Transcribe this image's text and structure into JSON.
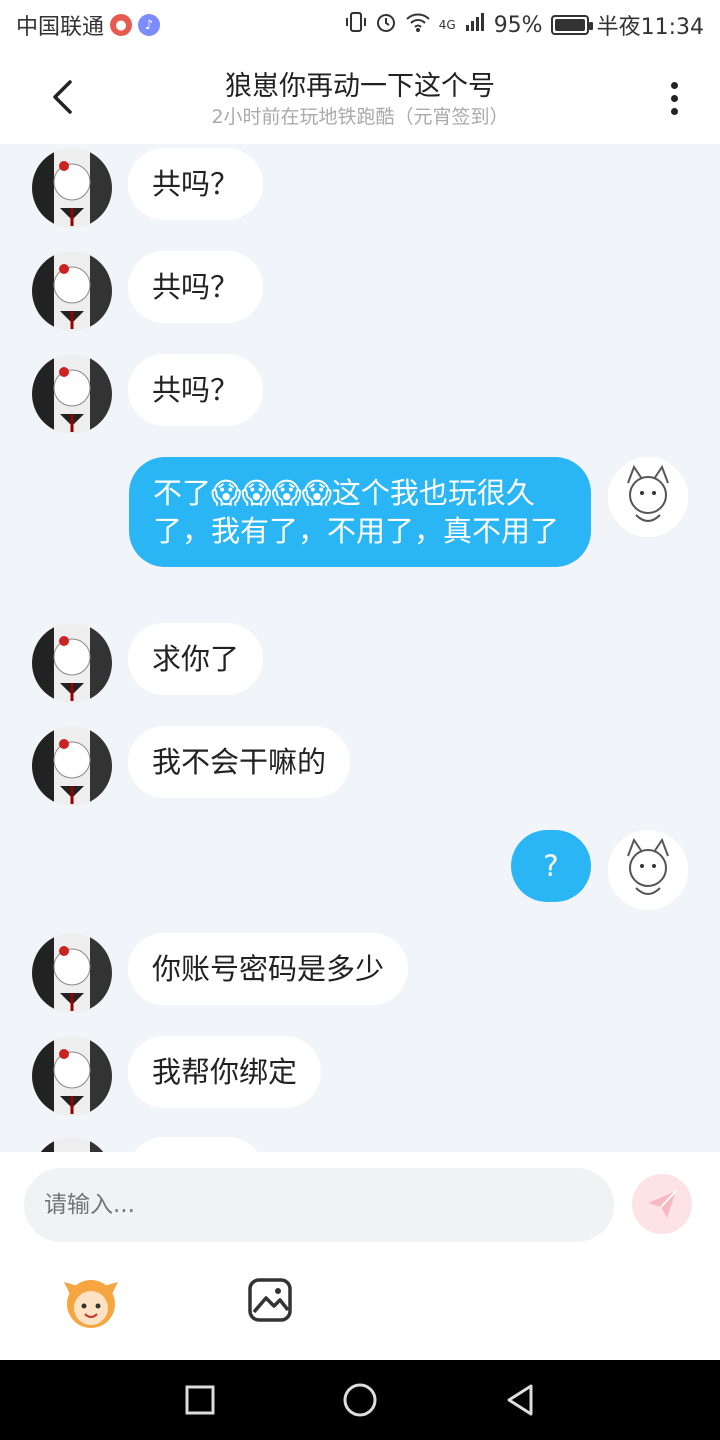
{
  "status_bar": {
    "carrier": "中国联通",
    "signal": "4G",
    "battery": "95%",
    "time": "半夜11:34"
  },
  "header": {
    "title": "狼崽你再动一下这个号",
    "subtitle": "2小时前在玩地铁跑酷（元宵签到）"
  },
  "messages": [
    {
      "side": "in",
      "text": "共吗？"
    },
    {
      "side": "in",
      "text": "共吗？"
    },
    {
      "side": "in",
      "text": "共吗？"
    },
    {
      "side": "out",
      "text": "不了😱😱😱😱这个我也玩很久了，我有了，不用了，真不用了"
    },
    {
      "side": "in",
      "text": "求你了"
    },
    {
      "side": "in",
      "text": "我不会干嘛的"
    },
    {
      "side": "out",
      "text": "?"
    },
    {
      "side": "in",
      "text": "你账号密码是多少"
    },
    {
      "side": "in",
      "text": "我帮你绑定"
    }
  ],
  "input": {
    "placeholder": "请输入..."
  },
  "colors": {
    "accent": "#2ab5f5",
    "chat_bg": "#f1f4f8",
    "send_bg": "#fde3e6"
  },
  "icons": {
    "back": "chevron-left-icon",
    "more": "more-vertical-icon",
    "send": "send-icon",
    "emoji": "emoji-icon",
    "image": "image-icon"
  }
}
